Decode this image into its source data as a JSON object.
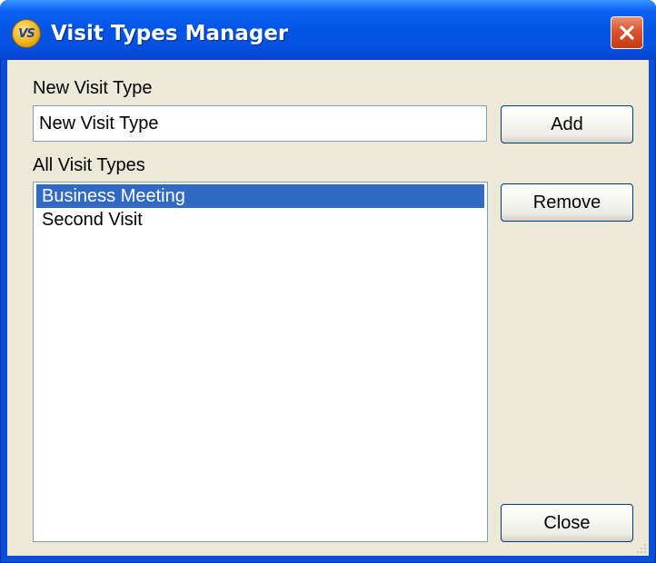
{
  "window": {
    "title": "Visit Types Manager",
    "icon_text": "VS",
    "icon": "vs-app-icon",
    "close_icon": "close-icon"
  },
  "form": {
    "new_type_label": "New Visit Type",
    "new_type_value": "New Visit Type",
    "list_label": "All Visit Types",
    "visit_types": [
      {
        "label": "Business Meeting",
        "selected": true
      },
      {
        "label": "Second Visit",
        "selected": false
      }
    ]
  },
  "buttons": {
    "add": "Add",
    "remove": "Remove",
    "close": "Close"
  },
  "colors": {
    "titlebar": "#0355e6",
    "client_bg": "#ece9d8",
    "selection": "#316ac5",
    "close_button": "#d9532c"
  }
}
